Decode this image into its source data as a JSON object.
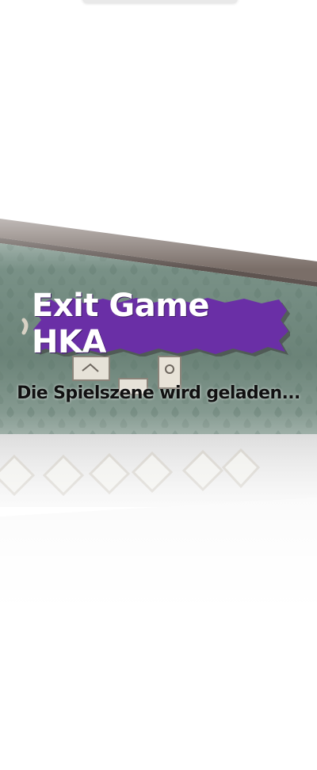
{
  "loader": {
    "title": "Exit Game HKA",
    "status": "Die Spielszene wird geladen..."
  },
  "colors": {
    "badge": "#6a2fa6",
    "wall": "#6f8a80",
    "ceiling": "#7a6f6a",
    "floor": "#f2f2f2"
  },
  "icons": {
    "wall_tiles": "diamond-tile-icon",
    "picture_frames": "picture-frame-icon"
  }
}
